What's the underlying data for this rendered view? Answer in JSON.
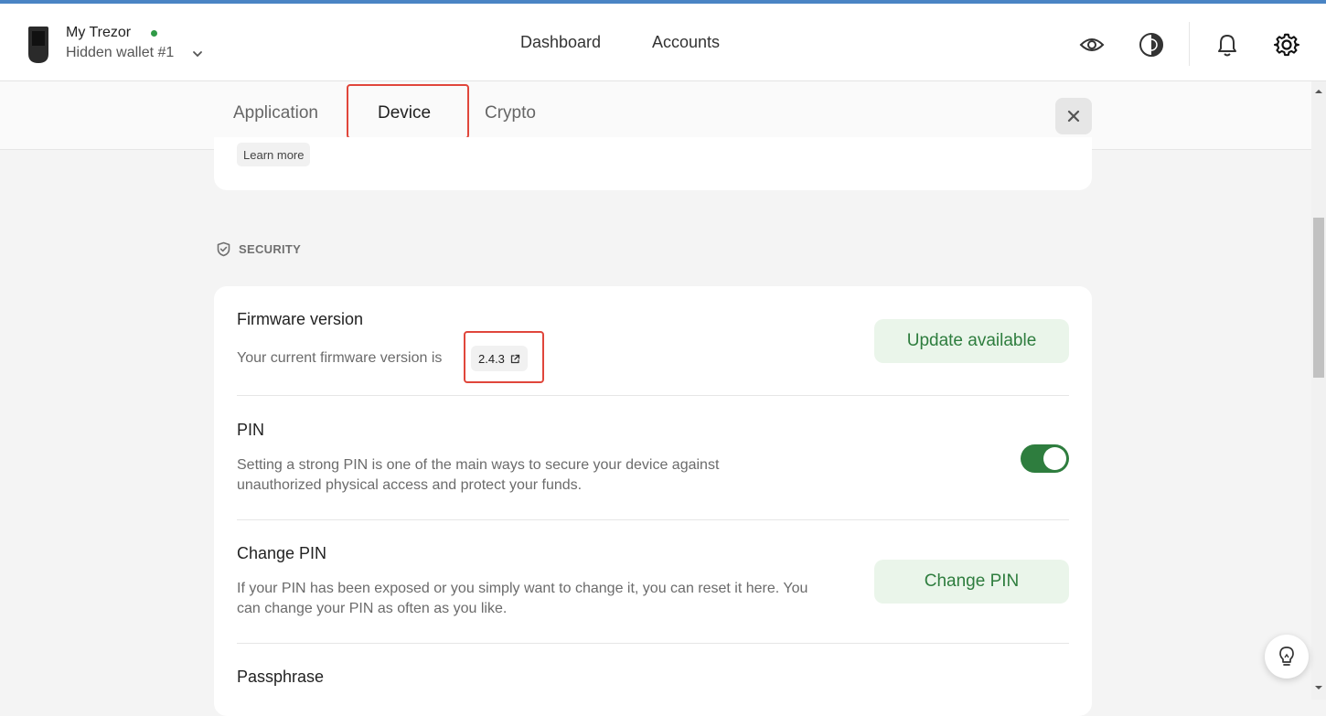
{
  "header": {
    "device_name": "My Trezor",
    "wallet_name": "Hidden wallet #1",
    "nav": [
      "Dashboard",
      "Accounts"
    ],
    "icons": [
      "eye-icon",
      "theme-icon",
      "bell-icon",
      "gear-icon"
    ]
  },
  "tabs": {
    "items": [
      "Application",
      "Device",
      "Crypto"
    ],
    "active": "Device"
  },
  "top_card": {
    "learn_more": "Learn more"
  },
  "security": {
    "section_label": "SECURITY",
    "firmware": {
      "title": "Firmware version",
      "desc": "Your current firmware version is",
      "version": "2.4.3",
      "button": "Update available"
    },
    "pin": {
      "title": "PIN",
      "desc": "Setting a strong PIN is one of the main ways to secure your device against unauthorized physical access and protect your funds.",
      "enabled": true
    },
    "change_pin": {
      "title": "Change PIN",
      "desc": "If your PIN has been exposed or you simply want to change it, you can reset it here. You can change your PIN as often as you like.",
      "button": "Change PIN"
    },
    "passphrase": {
      "title": "Passphrase"
    }
  },
  "colors": {
    "accent_green": "#2e7d3e",
    "highlight_red": "#e0463b",
    "top_bar_blue": "#4a84c4"
  }
}
